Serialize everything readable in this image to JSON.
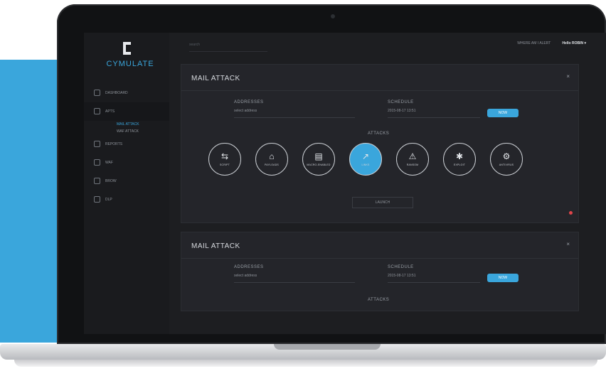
{
  "brand": {
    "name": "CYMULATE",
    "accent": "#3aa6dc"
  },
  "topbar": {
    "search_placeholder": "search",
    "notice": "WHERE AM I ALERT",
    "user": "Hello ROBIN",
    "user_caret": "▾"
  },
  "sidebar": {
    "items": [
      {
        "label": "DASHBOARD",
        "icon": "dashboard-icon"
      },
      {
        "label": "APTS",
        "icon": "apts-icon",
        "active": true,
        "subitems": [
          {
            "label": "MAIL ATTACK",
            "active": true
          },
          {
            "label": "WAF ATTACK"
          }
        ]
      },
      {
        "label": "REPORTS",
        "icon": "reports-icon"
      },
      {
        "label": "WAF",
        "icon": "waf-icon"
      },
      {
        "label": "BROW",
        "icon": "browser-icon"
      },
      {
        "label": "DLP",
        "icon": "dlp-icon"
      }
    ]
  },
  "panel1": {
    "title": "MAIL ATTACK",
    "close": "×",
    "address_label": "ADDRESSES",
    "address_value": "select address",
    "schedule_label": "SCHEDULE",
    "schedule_value": "2015-08-17 13:51",
    "now_button": "NOW",
    "attacks_label": "ATTACKS",
    "attacks": [
      {
        "label": "SCRIPT",
        "icon": "script-icon",
        "glyph": "⇆"
      },
      {
        "label": "PAYLOADS",
        "icon": "payload-icon",
        "glyph": "⌂"
      },
      {
        "label": "MACRO-ENABLED",
        "icon": "macro-icon",
        "glyph": "▤"
      },
      {
        "label": "LINKS",
        "icon": "link-icon",
        "glyph": "↗",
        "active": true
      },
      {
        "label": "RANSOM",
        "icon": "ransom-icon",
        "glyph": "⚠"
      },
      {
        "label": "EXPLOIT",
        "icon": "exploit-icon",
        "glyph": "✱"
      },
      {
        "label": "ANTIVIRUS",
        "icon": "antivirus-icon",
        "glyph": "⚙"
      }
    ],
    "launch_button": "LAUNCH"
  },
  "panel2": {
    "title": "MAIL ATTACK",
    "close": "×",
    "address_label": "ADDRESSES",
    "address_value": "select address",
    "schedule_label": "SCHEDULE",
    "schedule_value": "2015-08-17 13:51",
    "now_button": "NOW",
    "attacks_label": "ATTACKS"
  }
}
